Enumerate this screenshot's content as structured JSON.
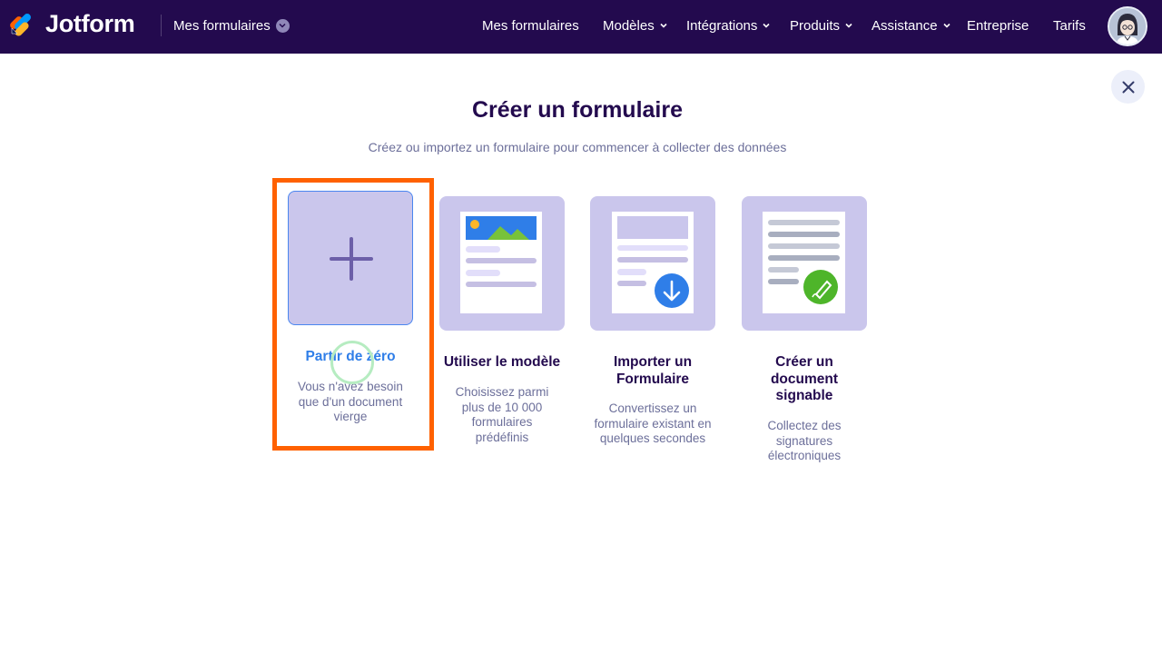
{
  "header": {
    "brand": "Jotform",
    "my_forms_dropdown": "Mes formulaires",
    "nav": [
      {
        "label": "Mes formulaires",
        "has_dropdown": false
      },
      {
        "label": "Modèles",
        "has_dropdown": true
      },
      {
        "label": "Intégrations",
        "has_dropdown": true
      },
      {
        "label": "Produits",
        "has_dropdown": true
      },
      {
        "label": "Assistance",
        "has_dropdown": true
      },
      {
        "label": "Entreprise",
        "has_dropdown": false
      },
      {
        "label": "Tarifs",
        "has_dropdown": false
      }
    ],
    "colors": {
      "background": "#230a4e"
    }
  },
  "modal": {
    "title": "Créer un formulaire",
    "subtitle": "Créez ou importez un formulaire pour commencer à collecter des données",
    "options": [
      {
        "label": "Partir de zéro",
        "description": "Vous n'avez besoin que d'un document vierge",
        "icon": "plus-icon",
        "selected": true
      },
      {
        "label": "Utiliser le modèle",
        "description": "Choisissez parmi plus de 10 000 formulaires prédéfinis",
        "icon": "template-icon"
      },
      {
        "label": "Importer un Formulaire",
        "description": "Convertissez un formulaire existant en quelques secondes",
        "icon": "import-icon"
      },
      {
        "label": "Créer un document signable",
        "description": "Collectez des signatures électroniques",
        "icon": "signature-icon"
      }
    ],
    "colors": {
      "tile": "#cac6ec",
      "accent": "#2f7ee8",
      "highlight": "#ff6100",
      "heading": "#230a4e",
      "muted": "#6c6f9a"
    }
  }
}
